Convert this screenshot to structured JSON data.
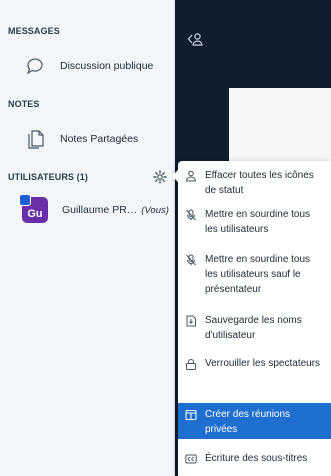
{
  "sidebar": {
    "messages_title": "MESSAGES",
    "public_chat_label": "Discussion publique",
    "notes_title": "NOTES",
    "shared_notes_label": "Notes Partagées",
    "users_title": "UTILISATEURS (1)",
    "user": {
      "initials": "Gu",
      "name": "Guillaume PR…",
      "you_label": "(Vous)",
      "avatar_color": "#6a2fa8"
    }
  },
  "user_menu": {
    "items": [
      {
        "icon": "user-icon",
        "label": "Effacer toutes les icônes de statut"
      },
      {
        "icon": "mute-icon",
        "label": "Mettre en sourdine tous les utilisateurs"
      },
      {
        "icon": "mute-icon",
        "label": "Mettre en sourdine tous les utilisateurs sauf le présentateur"
      },
      {
        "icon": "save-icon",
        "label": "Sauvegarde les noms d'utilisateur"
      },
      {
        "icon": "lock-icon",
        "label": "Verrouiller les spectateurs"
      },
      {
        "icon": "breakout-rooms-icon",
        "label": "Créer des réunions privées"
      },
      {
        "icon": "closed-captions-icon",
        "label": "Écriture des sous-titres"
      }
    ],
    "active_color": "#1f6fd1"
  }
}
